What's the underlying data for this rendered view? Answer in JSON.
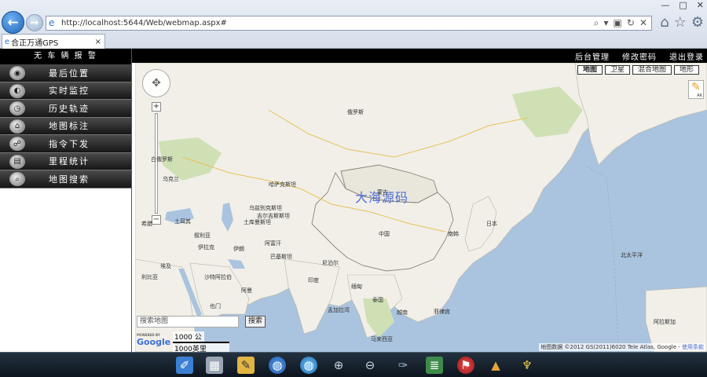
{
  "browser": {
    "url": "http://localhost:5644/Web/webmap.aspx#",
    "tab_title": "合正万通GPS",
    "tab_close": "×",
    "window_controls": [
      "—",
      "□",
      "✕"
    ]
  },
  "sidebar": {
    "title": "无 车 辆 报 警",
    "items": [
      {
        "label": "最后位置",
        "icon": "location-icon"
      },
      {
        "label": "实时监控",
        "icon": "monitor-icon"
      },
      {
        "label": "历史轨迹",
        "icon": "history-icon"
      },
      {
        "label": "地图标注",
        "icon": "map-marker-icon"
      },
      {
        "label": "指令下发",
        "icon": "command-icon"
      },
      {
        "label": "里程统计",
        "icon": "mileage-icon"
      },
      {
        "label": "地图搜索",
        "icon": "map-search-icon"
      }
    ]
  },
  "topbar": {
    "links": [
      "后台管理",
      "修改密码",
      "退出登录"
    ]
  },
  "map": {
    "types": [
      "地图",
      "卫星",
      "混合地图",
      "地形"
    ],
    "watermark": "大海源码",
    "search_placeholder": "搜索地图",
    "search_button": "搜索",
    "scale_km": "1000 公里",
    "scale_mi": "1000英里",
    "copyright": "地图数据 ©2012 GS(2011)6020 Tele Atlas, Google - ",
    "terms": "使用条款",
    "pegman_label": "AK",
    "google_logo": "Google",
    "powered_by": "POWERED BY",
    "labels": [
      {
        "text": "俄罗斯"
      },
      {
        "text": "中国"
      },
      {
        "text": "蒙古"
      },
      {
        "text": "哈萨克斯坦"
      },
      {
        "text": "日本"
      },
      {
        "text": "南韩"
      },
      {
        "text": "印度"
      },
      {
        "text": "伊朗"
      },
      {
        "text": "巴基斯坦"
      },
      {
        "text": "阿富汗"
      },
      {
        "text": "沙特阿拉伯"
      },
      {
        "text": "埃及"
      },
      {
        "text": "土耳其"
      },
      {
        "text": "乌克兰"
      },
      {
        "text": "白俄罗斯"
      },
      {
        "text": "伊拉克"
      },
      {
        "text": "泰国"
      },
      {
        "text": "越南"
      },
      {
        "text": "缅甸"
      },
      {
        "text": "菲律宾"
      },
      {
        "text": "马来西亚"
      },
      {
        "text": "孟加拉湾"
      },
      {
        "text": "北太平洋"
      },
      {
        "text": "阿拉斯加"
      },
      {
        "text": "吉尔吉斯斯坦"
      },
      {
        "text": "乌兹别克斯坦"
      },
      {
        "text": "土库曼斯坦"
      },
      {
        "text": "尼泊尔"
      },
      {
        "text": "苏丹"
      },
      {
        "text": "也门"
      },
      {
        "text": "叙利亚"
      },
      {
        "text": "希腊"
      },
      {
        "text": "利比亚"
      },
      {
        "text": "阿曼"
      }
    ]
  },
  "taskbar": {
    "icons": [
      "ruler-icon",
      "image-icon",
      "notes-icon",
      "globe-icon",
      "globe2-icon",
      "zoom-in-icon",
      "zoom-out-icon",
      "draw-icon",
      "layers-icon",
      "flag-icon",
      "warning-icon",
      "broom-icon"
    ]
  }
}
